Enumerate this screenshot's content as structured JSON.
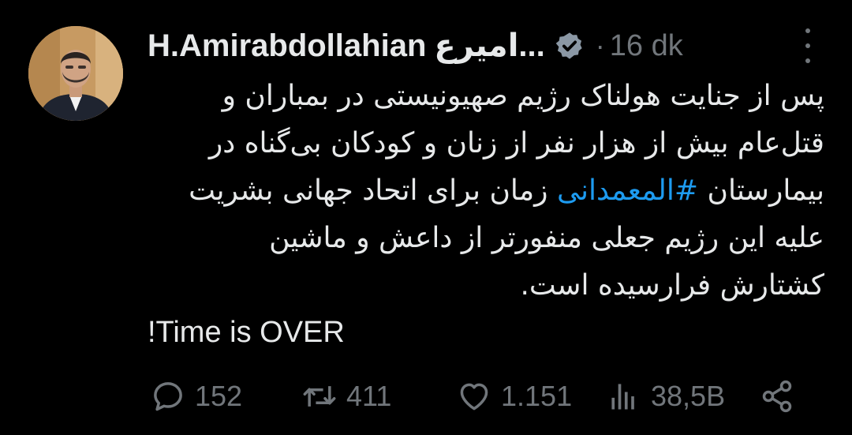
{
  "tweet": {
    "author_name": "H.Amirabdollahian",
    "author_name_suffix": "امیرع...",
    "separator": "·",
    "time": "16 dk",
    "body_lines": [
      "پس از جنایت هولناک رژیم صهیونیستی در بمباران و",
      "قتل‌عام بیش از هزار نفر از زنان و کودکان بی‌گناه در",
      "بیمارستان",
      "زمان برای اتحاد جهانی بشریت",
      "علیه این رژیم جعلی منفورتر از داعش و ماشین",
      "کشتارش فرارسیده است."
    ],
    "hashtag": "#المعمدانی",
    "english_line": "!Time is OVER",
    "hashtag_color": "#1d9bf0",
    "verified_color": "#8b98a5"
  },
  "actions": {
    "reply_count": "152",
    "retweet_count": "411",
    "like_count": "1.151",
    "views_count": "38,5B"
  },
  "icons": {
    "reply": "reply-icon",
    "retweet": "retweet-icon",
    "like": "heart-icon",
    "views": "views-chart-icon",
    "share": "share-icon",
    "more": "more-vertical-icon",
    "verified": "verified-badge-icon"
  }
}
